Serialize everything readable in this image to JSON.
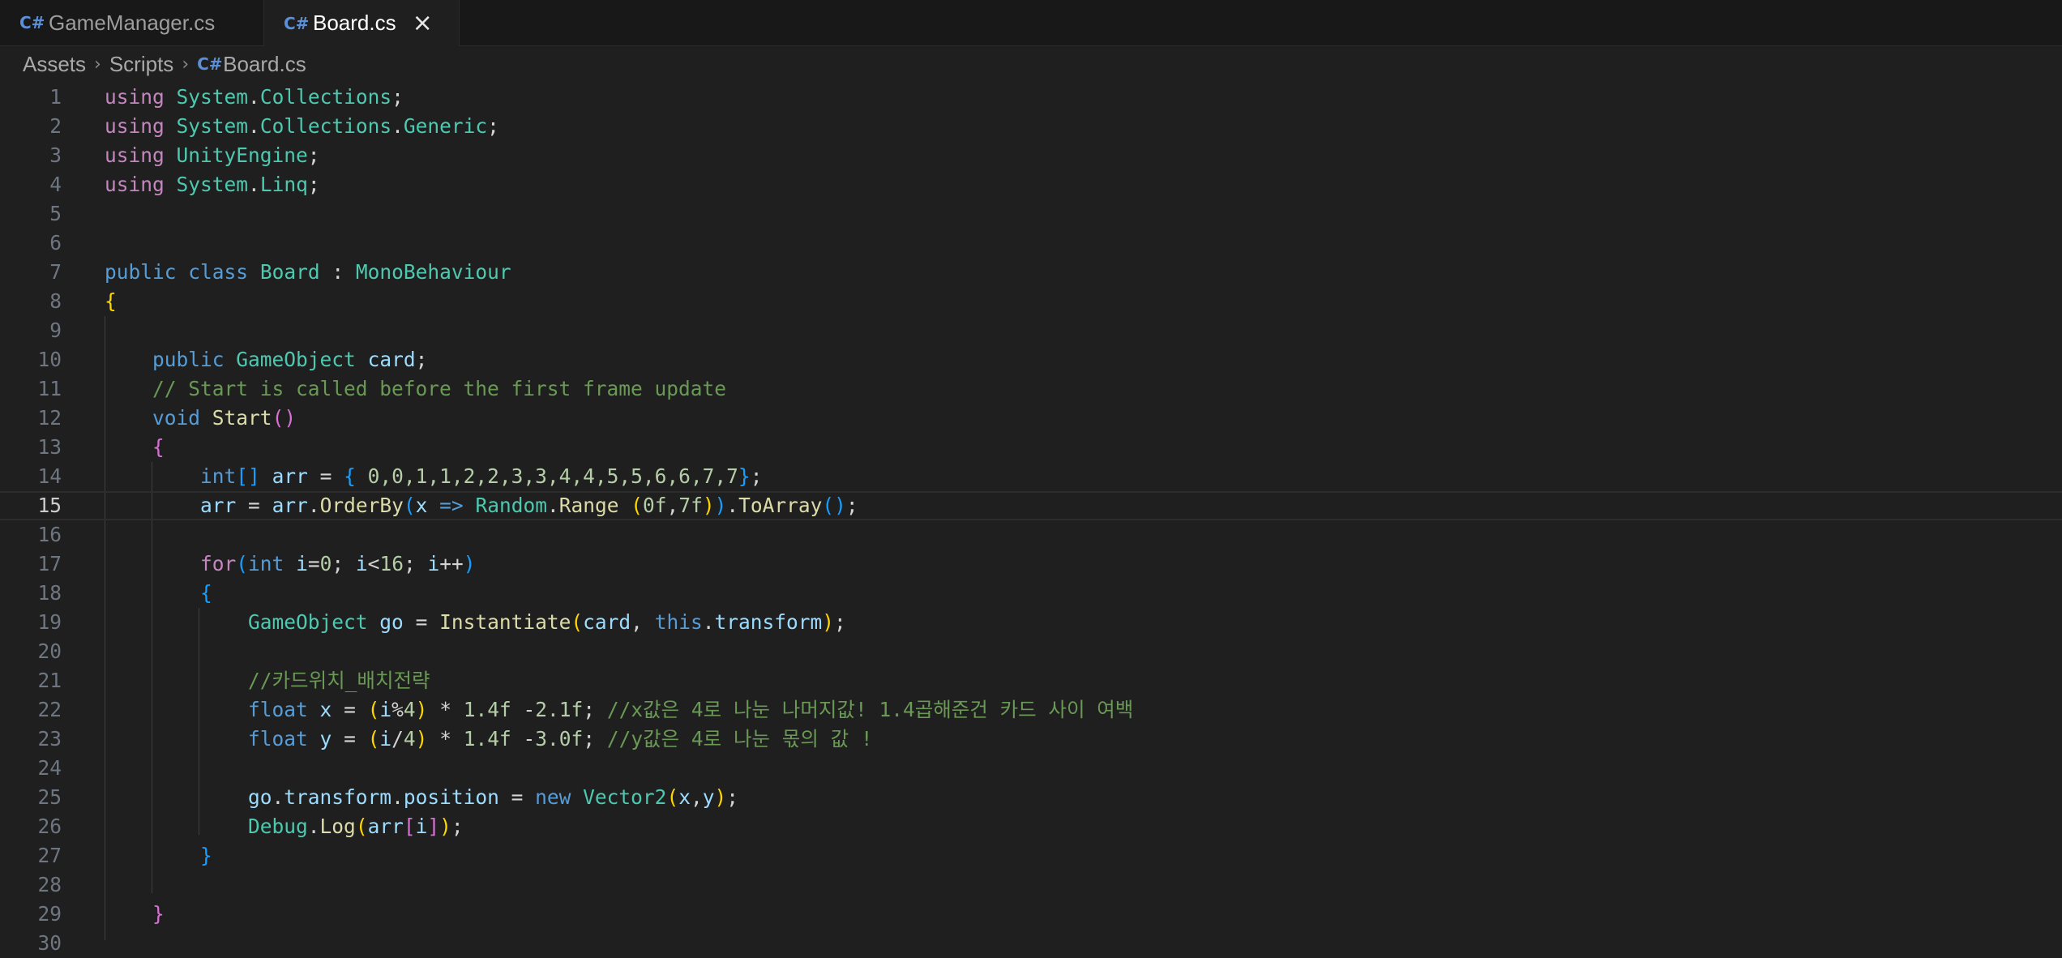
{
  "tabs": [
    {
      "label": "GameManager.cs",
      "icon": "csharp-file-icon",
      "active": false
    },
    {
      "label": "Board.cs",
      "icon": "csharp-file-icon",
      "active": true
    }
  ],
  "breadcrumb": [
    "Assets",
    "Scripts",
    "Board.cs"
  ],
  "active_line": 15,
  "code": {
    "line_numbers": [
      "1",
      "2",
      "3",
      "4",
      "5",
      "6",
      "7",
      "8",
      "9",
      "10",
      "11",
      "12",
      "13",
      "14",
      "15",
      "16",
      "17",
      "18",
      "19",
      "20",
      "21",
      "22",
      "23",
      "24",
      "25",
      "26",
      "27",
      "28",
      "29",
      "30"
    ],
    "l1": {
      "kw": "using",
      "ns": "System",
      "rest": ".Collections;"
    },
    "l1_ns2": "Collections",
    "l2_ns2": "Collections",
    "l2_ns3": "Generic",
    "l3_ns": "UnityEngine",
    "l4_ns2": "Linq",
    "comment_11": "// Start is called before the first frame update",
    "comment_21": "//카드위치_배치전략",
    "comment_22": "//x값은 4로 나눈 나머지값! 1.4곱해준건 카드 사이 여백",
    "comment_23": "//y값은 4로 나눈 몫의 값 !",
    "arr_values": "0,0,1,1,2,2,3,3,4,4,5,5,6,6,7,7"
  },
  "colors": {
    "background": "#1f1f1f",
    "keyword": "#569cd6",
    "control": "#c586c0",
    "type": "#4ec9b0",
    "variable": "#9cdcfe",
    "function": "#dcdcaa",
    "number": "#b5cea8",
    "comment": "#6a9955"
  }
}
